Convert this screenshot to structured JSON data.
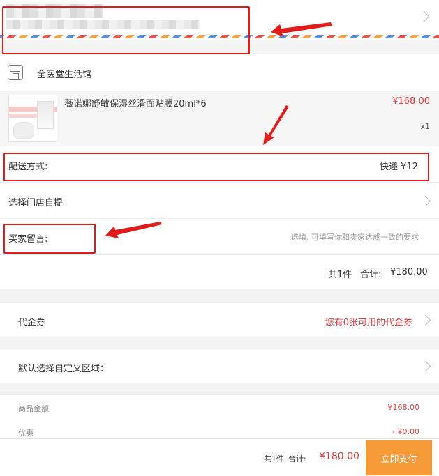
{
  "store": {
    "name": "全医堂生活馆"
  },
  "product": {
    "title": "薇诺娜舒敏保湿丝滑面贴膜20ml*6",
    "price": "¥168.00",
    "quantity": "x1"
  },
  "shipping": {
    "label": "配送方式:",
    "value": "快递 ¥12"
  },
  "pickup": {
    "label": "选择门店自提"
  },
  "message": {
    "label": "买家留言:",
    "placeholder": "选填, 可填写你和卖家达成一致的要求"
  },
  "subtotal": {
    "count": "共1件",
    "label": "合计:",
    "amount": "¥180.00"
  },
  "coupon": {
    "label": "代金券",
    "value": "您有0张可用的代金券"
  },
  "custom_area": {
    "label": "默认选择自定义区域："
  },
  "summary": {
    "goods_label": "商品金额",
    "goods_value": "¥168.00",
    "discount_label": "优惠",
    "discount_value": "- ¥0.00"
  },
  "bottom_bar": {
    "count": "共1件",
    "label": "合计:",
    "total": "¥180.00",
    "pay_label": "立即支付"
  },
  "colors": {
    "price_red": "#e93b3d",
    "pay_orange": "#f59a36",
    "annotation_red": "#e21b1b"
  },
  "icons": [
    "store-icon",
    "chevron-right-icon"
  ]
}
